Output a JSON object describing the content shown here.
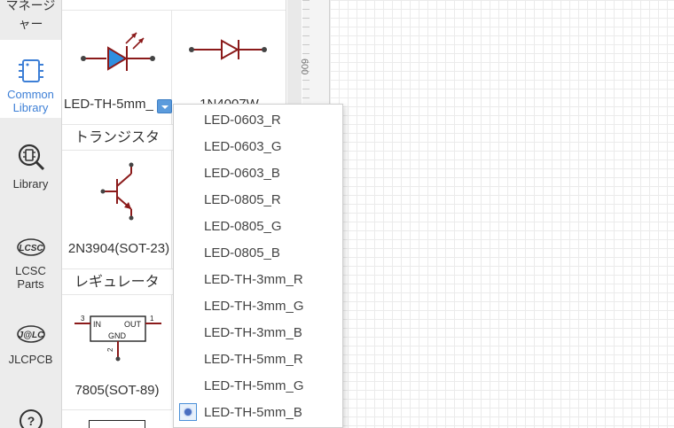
{
  "sidebar": {
    "items": [
      {
        "label": "マネージ\nャー",
        "icon": "manager-icon"
      },
      {
        "label": "Common\nLibrary",
        "icon": "chip-icon",
        "active": true
      },
      {
        "label": "Library",
        "icon": "library-search-icon"
      },
      {
        "label": "LCSC\nParts",
        "icon": "lcsc-logo-icon"
      },
      {
        "label": "JLCPCB",
        "icon": "jlc-logo-icon"
      },
      {
        "label": "",
        "icon": "help-icon"
      }
    ]
  },
  "panel": {
    "led_cell_name": "LED-TH-5mm_",
    "diode_cell_name": "1N4007W",
    "category_transistor": "トランジスタ",
    "transistor_cell_name": "2N3904(SOT-23)",
    "category_regulator": "レギュレータ",
    "regulator_cell_name": "7805(SOT-89)",
    "regulator_symbol": {
      "in": "IN",
      "out": "OUT",
      "gnd": "GND",
      "pin1": "1",
      "pin2": "2",
      "pin3": "3"
    }
  },
  "ruler": {
    "label": "600"
  },
  "dropdown": {
    "options": [
      "LED-0603_R",
      "LED-0603_G",
      "LED-0603_B",
      "LED-0805_R",
      "LED-0805_G",
      "LED-0805_B",
      "LED-TH-3mm_R",
      "LED-TH-3mm_G",
      "LED-TH-3mm_B",
      "LED-TH-5mm_R",
      "LED-TH-5mm_G",
      "LED-TH-5mm_B"
    ],
    "selected": "LED-TH-5mm_B"
  },
  "colors": {
    "accent": "#3d7fd6",
    "symbol": "#8b1a1a",
    "led_fill": "#2f8fe0"
  }
}
